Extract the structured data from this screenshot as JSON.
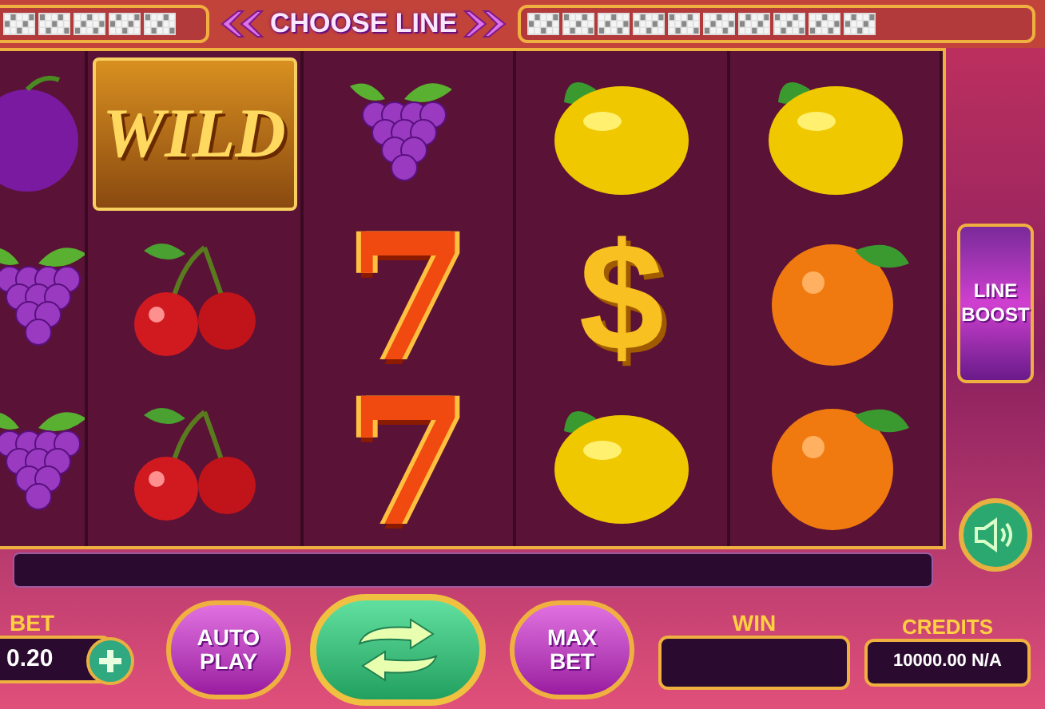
{
  "top_bar": {
    "title": "CHOOSE LINE"
  },
  "reels": [
    {
      "symbols": [
        {
          "kind": "plum"
        },
        {
          "kind": "grapes"
        },
        {
          "kind": "grapes"
        }
      ]
    },
    {
      "symbols": [
        {
          "kind": "wild",
          "label": "WILD"
        },
        {
          "kind": "cherry"
        },
        {
          "kind": "cherry"
        }
      ]
    },
    {
      "symbols": [
        {
          "kind": "grapes"
        },
        {
          "kind": "seven",
          "label": "7"
        },
        {
          "kind": "seven",
          "label": "7"
        }
      ]
    },
    {
      "symbols": [
        {
          "kind": "lemon"
        },
        {
          "kind": "dollar",
          "label": "$"
        },
        {
          "kind": "lemon"
        }
      ]
    },
    {
      "symbols": [
        {
          "kind": "lemon"
        },
        {
          "kind": "orange"
        },
        {
          "kind": "orange"
        }
      ]
    }
  ],
  "line_boost": {
    "label": "LINE BOOST"
  },
  "bet": {
    "label": "BET",
    "value": "0.20"
  },
  "auto_play": {
    "label": "AUTO PLAY"
  },
  "max_bet": {
    "label": "MAX BET"
  },
  "win": {
    "label": "WIN"
  },
  "credits": {
    "label": "CREDITS",
    "value": "10000.00 N/A"
  }
}
